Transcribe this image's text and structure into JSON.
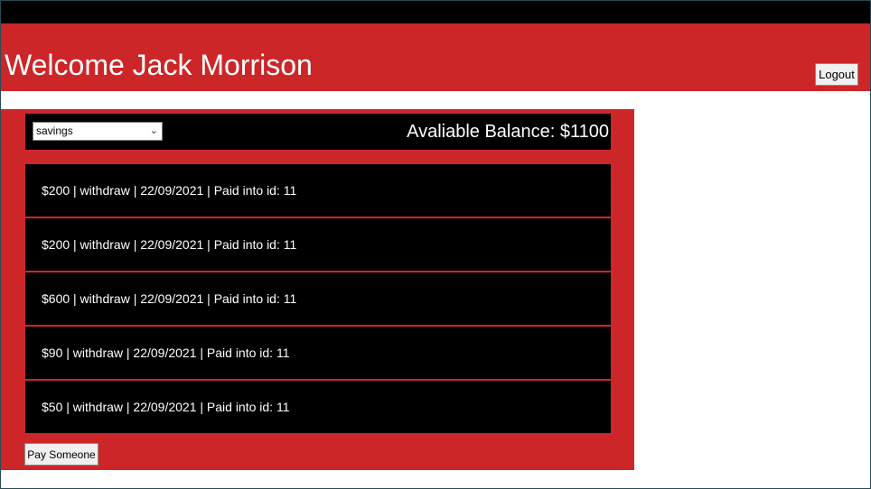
{
  "header": {
    "welcome_text": "Welcome Jack Morrison",
    "logout_label": "Logout"
  },
  "account": {
    "selected": "savings",
    "balance_text": "Avaliable Balance: $1100"
  },
  "transactions": [
    {
      "text": "$200 | withdraw | 22/09/2021 | Paid into id: 11"
    },
    {
      "text": "$200 | withdraw | 22/09/2021 | Paid into id: 11"
    },
    {
      "text": "$600 | withdraw | 22/09/2021 | Paid into id: 11"
    },
    {
      "text": "$90 | withdraw | 22/09/2021 | Paid into id: 11"
    },
    {
      "text": "$50 | withdraw | 22/09/2021 | Paid into id: 11"
    }
  ],
  "actions": {
    "pay_label": "Pay Someone"
  },
  "colors": {
    "brand_red": "#cc2629",
    "panel_black": "#000000"
  }
}
